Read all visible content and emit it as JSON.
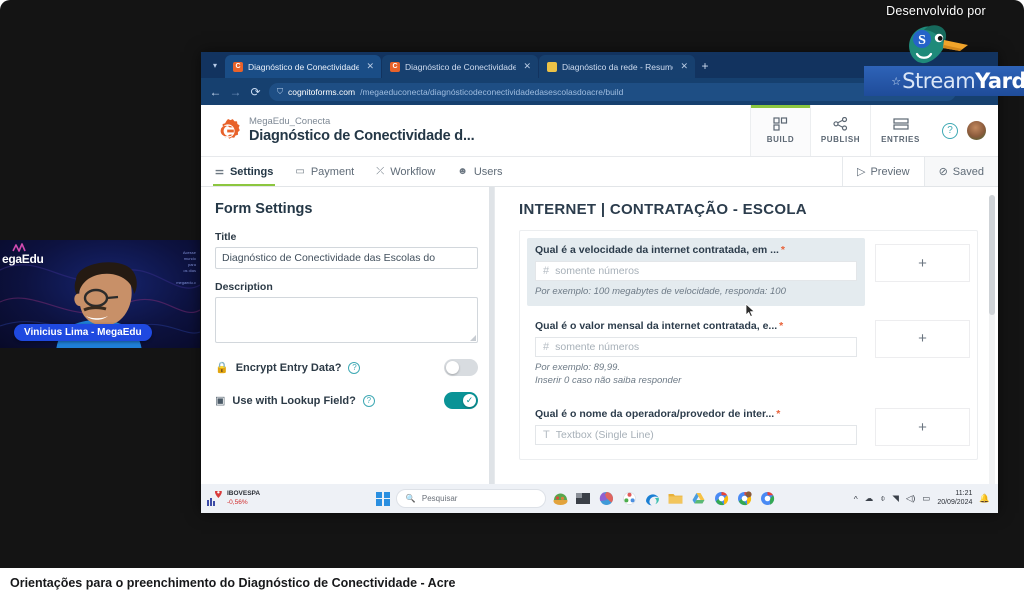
{
  "branding": {
    "developed_by": "Desenvolvido por",
    "streamyard_light": "Stream",
    "streamyard_bold": "Yard",
    "star_glyph": "☆",
    "duck_badge_letter": "S"
  },
  "webcam": {
    "name_tag": "Vinicius Lima - MegaEdu",
    "logo_text": "egaEdu",
    "side_text_lines": [
      "Acesse",
      "mundo",
      "para",
      "os dias",
      "",
      "megaedu.c"
    ]
  },
  "browser": {
    "tab_list_icon": "chevron-down",
    "tabs": [
      {
        "title": "Diagnóstico de Conectividade",
        "favicon": "cognito-cog",
        "active": true,
        "close_glyph": "✕"
      },
      {
        "title": "Diagnóstico de Conectividade",
        "favicon": "cognito-cog",
        "active": false,
        "close_glyph": "✕"
      },
      {
        "title": "Diagnóstico da rede - Resumo",
        "favicon": "document",
        "active": false,
        "close_glyph": "✕"
      }
    ],
    "new_tab_glyph": "+",
    "back_glyph": "←",
    "forward_glyph": "→",
    "reload_glyph": "⟳",
    "url_lock_glyph": "⛉",
    "url_host": "cognitoforms.com",
    "url_path": "/megaeduconecta/diagnósticodeconectividadedasescolasdoacre/build",
    "right_icons": [
      "cast-icon",
      "search-icon"
    ]
  },
  "app": {
    "org_name": "MegaEdu_Conecta",
    "form_name": "Diagnóstico de Conectividade d...",
    "mode_tabs": [
      {
        "label": "BUILD",
        "icon": "grid-icon",
        "active": true
      },
      {
        "label": "PUBLISH",
        "icon": "share-icon",
        "active": false
      },
      {
        "label": "ENTRIES",
        "icon": "rows-icon",
        "active": false
      }
    ],
    "help_glyph": "?",
    "avatar": "user-avatar"
  },
  "settings_nav": {
    "items": [
      {
        "label": "Settings",
        "icon": "sliders-icon",
        "active": true
      },
      {
        "label": "Payment",
        "icon": "card-icon",
        "active": false
      },
      {
        "label": "Workflow",
        "icon": "shuffle-icon",
        "active": false
      },
      {
        "label": "Users",
        "icon": "user-icon",
        "active": false
      }
    ],
    "preview_label": "Preview",
    "preview_glyph": "▷",
    "saved_label": "Saved",
    "saved_glyph": "⊘"
  },
  "form_settings": {
    "heading": "Form Settings",
    "title_label": "Title",
    "title_value": "Diagnóstico de Conectividade das Escolas do",
    "description_label": "Description",
    "description_value": "",
    "toggles": [
      {
        "label": "Encrypt Entry Data?",
        "icon": "lock-icon",
        "help_glyph": "?",
        "on": false
      },
      {
        "label": "Use with Lookup Field?",
        "icon": "lookup-icon",
        "help_glyph": "?",
        "on": true,
        "check_glyph": "✓"
      }
    ]
  },
  "form_preview": {
    "section_title": "INTERNET | CONTRATAÇÃO - ESCOLA",
    "add_button_glyph": "+",
    "required_glyph": "*",
    "questions": [
      {
        "label": "Qual é a velocidade da internet contratada, em ...",
        "required": true,
        "placeholder": "somente números",
        "placeholder_icon": "#",
        "help": "Por exemplo: 100 megabytes de velocidade, responda: 100",
        "selected": true
      },
      {
        "label": "Qual é o valor mensal da internet contratada, e...",
        "required": true,
        "placeholder": "somente números",
        "placeholder_icon": "#",
        "help": "Por exemplo: 89,99.\nInserir 0 caso não saiba responder",
        "selected": false
      },
      {
        "label": "Qual é o nome da operadora/provedor de inter...",
        "required": true,
        "placeholder": "Textbox (Single Line)",
        "placeholder_icon": "T",
        "help": "",
        "selected": false
      }
    ]
  },
  "taskbar": {
    "stock_name": "IBOVESPA",
    "stock_change": "-0,56%",
    "search_placeholder": "Pesquisar",
    "search_icon": "magnifier-icon",
    "start_icon": "windows-icon",
    "app_icons": [
      "weather-icon",
      "file-explorer-icon",
      "copilot-icon",
      "photos-icon",
      "edge-icon",
      "folder-icon",
      "drive-icon",
      "chrome-icon",
      "chrome-profile-icon",
      "chrome-alt-icon"
    ],
    "tray_glyphs": [
      "^",
      "☁",
      "🎤",
      "📶",
      "🔊",
      "🔋"
    ],
    "time": "11:21",
    "date": "20/09/2024",
    "bell_glyph": "🔔"
  },
  "caption": {
    "text": "Orientações para o preenchimento do Diagnóstico de Conectividade - Acre"
  }
}
